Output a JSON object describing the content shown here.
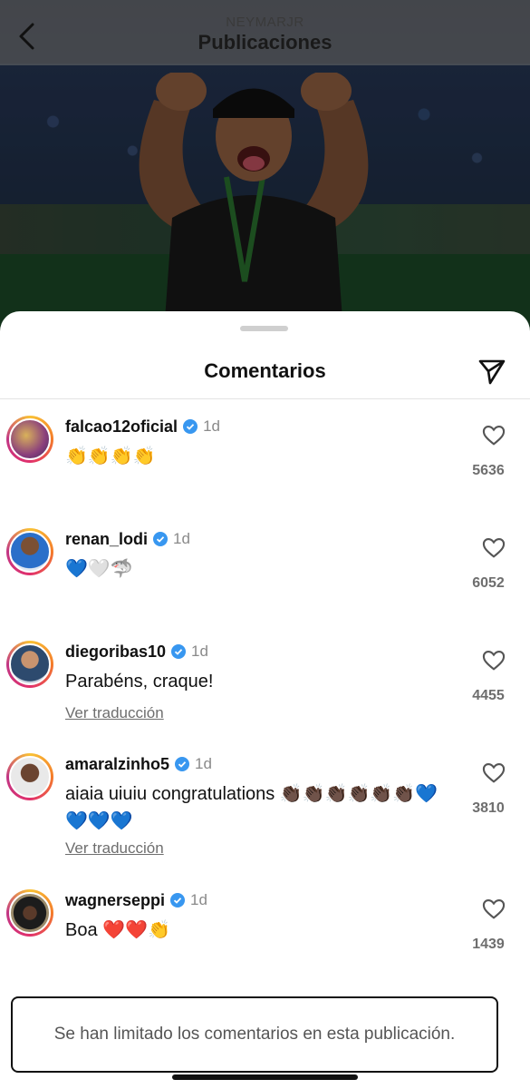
{
  "header": {
    "account": "NEYMARJR",
    "title": "Publicaciones"
  },
  "sheet": {
    "title": "Comentarios"
  },
  "comments": [
    {
      "username": "falcao12oficial",
      "time": "1d",
      "text": "👏👏👏👏",
      "likes": "5636",
      "translate": ""
    },
    {
      "username": "renan_lodi",
      "time": "1d",
      "text": "💙🤍🦈",
      "likes": "6052",
      "translate": ""
    },
    {
      "username": "diegoribas10",
      "time": "1d",
      "text": "Parabéns, craque!",
      "likes": "4455",
      "translate": "Ver traducción"
    },
    {
      "username": "amaralzinho5",
      "time": "1d",
      "text": "aiaia uiuiu congratulations 👏🏿👏🏿👏🏿👏🏿👏🏿👏🏿💙💙💙💙",
      "likes": "3810",
      "translate": "Ver traducción"
    },
    {
      "username": "wagnerseppi",
      "time": "1d",
      "text": "Boa ❤️❤️👏",
      "likes": "1439",
      "translate": ""
    }
  ],
  "footer": {
    "notice": "Se han limitado los comentarios en esta publicación."
  },
  "icons": {
    "back": "chevron-left-icon",
    "share": "paper-plane-icon",
    "like": "heart-icon",
    "verified": "verified-badge-icon"
  },
  "colors": {
    "verified": "#3897f0",
    "story_ring": "#e1306c"
  }
}
